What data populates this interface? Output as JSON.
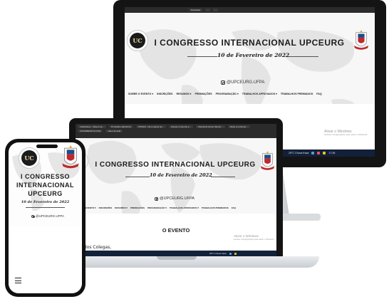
{
  "site": {
    "logo_left_mark": "UC",
    "title": "I CONGRESSO INTERNACIONAL UPCEURG",
    "title_phone_lines": [
      "I CONGRESSO",
      "INTERNACIONAL",
      "UPCEURG"
    ],
    "date": "10 de Fevereiro de 2022",
    "instagram": "@UPCEURG.UFPA",
    "nav": [
      "SOBRE O EVENTO ▾",
      "INSCRIÇÕES",
      "RESUMOS ▾",
      "PREMIAÇÕES",
      "PROGRAMAÇÃO ▾",
      "TRABALHOS APROVADOS ▾",
      "TRABALHOS PREMIADOS",
      "FAQ"
    ],
    "nav_laptop": [
      "E O EVENTO ▾",
      "INSCRIÇÕES",
      "RESUMOS ▾",
      "PREMIAÇÕES",
      "PROGRAMAÇÃO ▾",
      "TRABALHOS APROVADOS ▾",
      "TRABALHOS PREMIADOS",
      "FAQ"
    ],
    "section_heading": "O EVENTO",
    "greeting": "rmados Colegas,"
  },
  "windows": {
    "activate_title": "Ativar o Windows",
    "activate_sub": "Acesse Configurações para ativar o Windows."
  },
  "taskbar": {
    "weather": "25°C  Chuva fraca",
    "time": "17:36",
    "date": "10/02/2022"
  },
  "browser": {
    "tabs": [
      "Instantâneo - Slaves de...",
      "Prontuário Eletrônico",
      "PUMAS - Novo painel de...",
      "Acesso a internet e...",
      "Facebook Home Mentor...",
      "Ativar a conta de...",
      "CONGRESSO E FAQ",
      "vídeo da aula"
    ]
  },
  "colors": {
    "accent_red": "#c0282d",
    "accent_blue": "#1e4c8a",
    "taskbar": "#12203a",
    "bezel": "#141414"
  }
}
